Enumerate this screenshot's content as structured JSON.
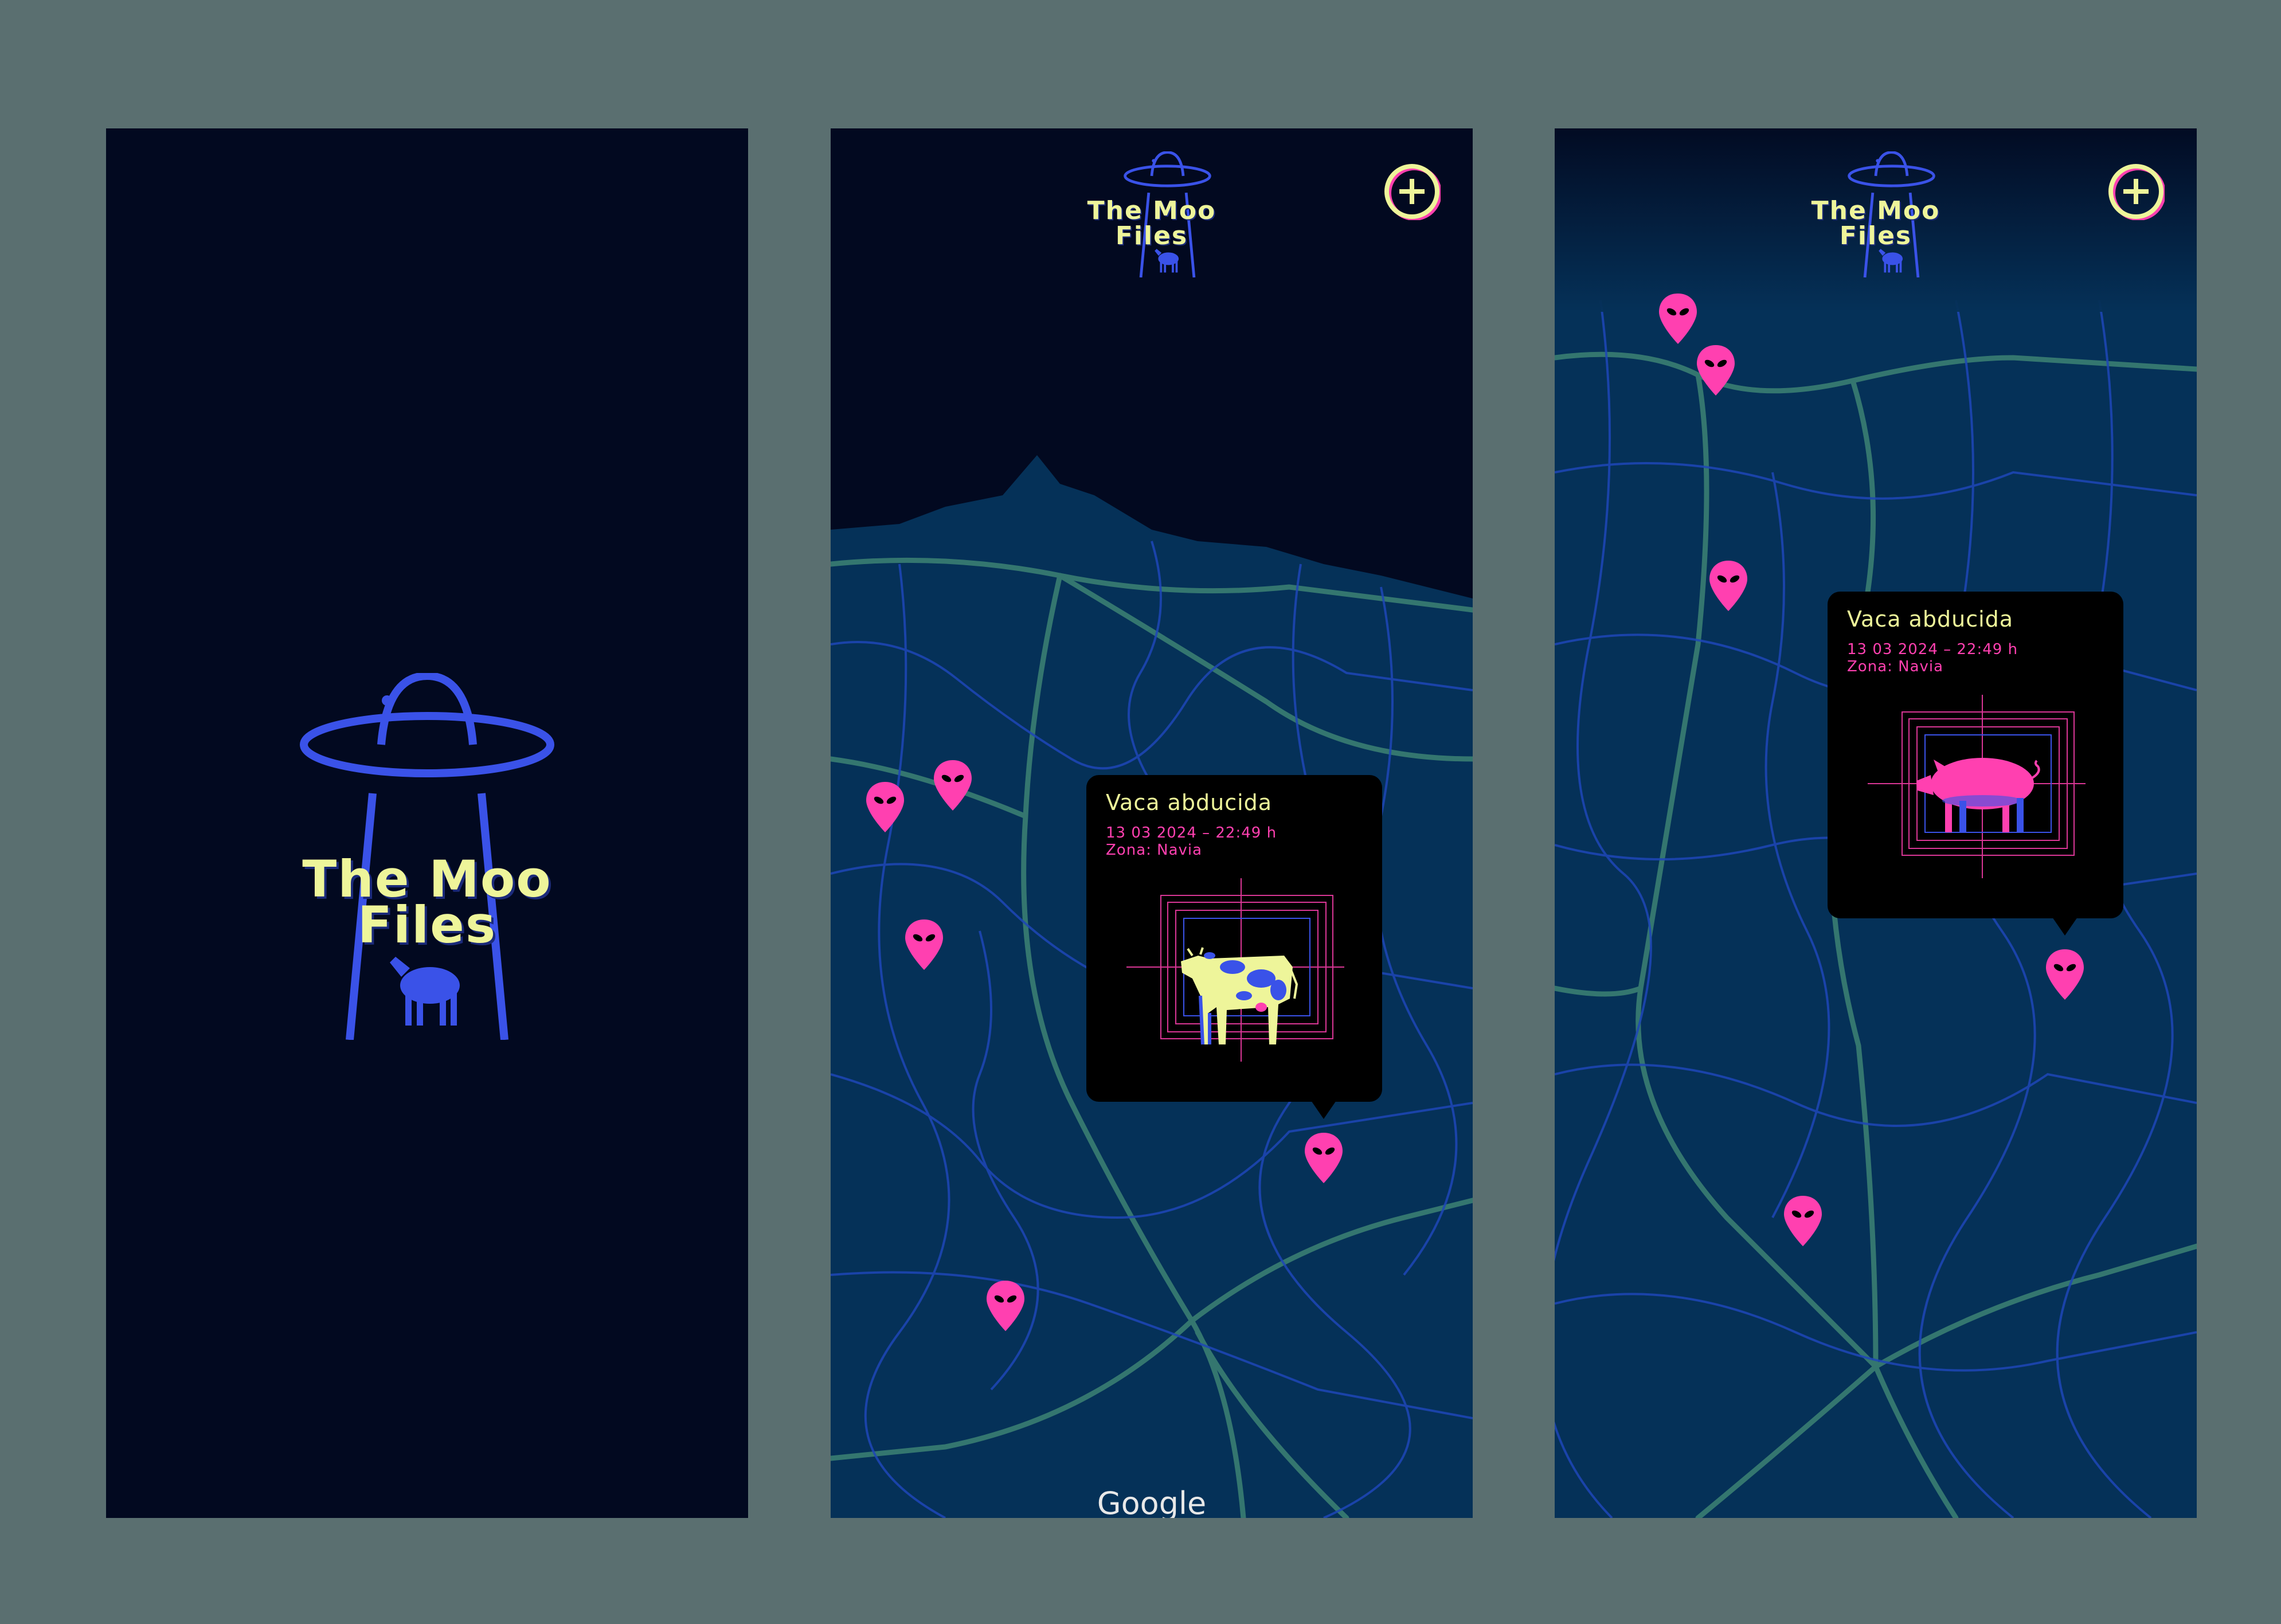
{
  "app": {
    "title": "The Moo\nFiles",
    "colors": {
      "background": "#5a6f70",
      "screen": "#020920",
      "map_land": "#053158",
      "road_main": "#3a7e72",
      "road_secondary": "#1e47b8",
      "accent_yellow": "#eef59a",
      "accent_blue": "#3a52e8",
      "marker_pink": "#ff40b0",
      "popup": "#000000"
    }
  },
  "splash": {
    "logo_title": "The Moo\nFiles",
    "logo_icon": "ufo-abducting-cow-icon"
  },
  "map_cow": {
    "header_title": "The Moo\nFiles",
    "add_button_icon": "plus-circle-icon",
    "marker_icon": "alien-pin-icon",
    "popup": {
      "title": "Vaca abducida",
      "date": "13 03 2024 – 22:49 h",
      "zone": "Zona: Navia",
      "image_icon": "cow-in-crosshair-icon"
    },
    "attribution": "Google"
  },
  "map_pig": {
    "header_title": "The Moo\nFiles",
    "add_button_icon": "plus-circle-icon",
    "marker_icon": "alien-pin-icon",
    "popup": {
      "title": "Vaca abducida",
      "date": "13 03 2024 – 22:49 h",
      "zone": "Zona: Navia",
      "image_icon": "pig-in-crosshair-icon"
    }
  }
}
